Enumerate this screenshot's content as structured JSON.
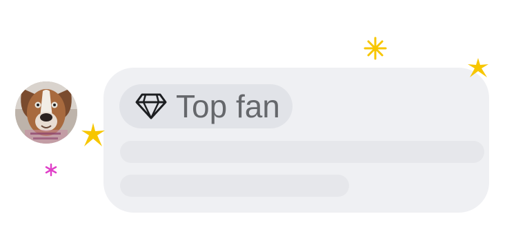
{
  "comment": {
    "author_avatar_icon": "dog-photo-avatar",
    "badge": {
      "icon": "diamond-icon",
      "label": "Top fan"
    }
  },
  "decorations": {
    "sparkle_colors": {
      "gold": "#f7c600",
      "pink": "#e040c8"
    }
  },
  "colors": {
    "bubble": "#eff0f3",
    "badge_bg": "#e1e3e8",
    "badge_text": "#65676b",
    "skeleton": "#e6e7eb"
  }
}
